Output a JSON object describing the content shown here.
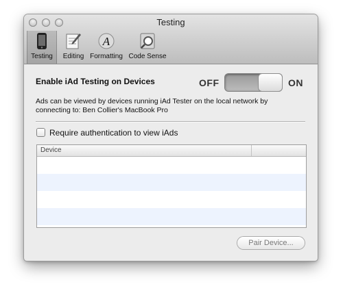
{
  "window": {
    "title": "Testing"
  },
  "toolbar": {
    "items": [
      {
        "label": "Testing",
        "icon": "iphone-icon",
        "selected": true
      },
      {
        "label": "Editing",
        "icon": "notepad-pencil-icon",
        "selected": false
      },
      {
        "label": "Formatting",
        "icon": "font-letter-icon",
        "selected": false
      },
      {
        "label": "Code Sense",
        "icon": "code-sense-icon",
        "selected": false
      }
    ]
  },
  "testing": {
    "heading": "Enable iAd Testing on Devices",
    "switch_off_label": "OFF",
    "switch_on_label": "ON",
    "switch_state": "on",
    "description": "Ads can be viewed by devices running iAd Tester on the local network by connecting to: Ben Collier's MacBook Pro",
    "auth_checkbox_label": "Require authentication to view iAds",
    "auth_checked": false
  },
  "devices_table": {
    "columns": [
      "Device",
      ""
    ],
    "rows": []
  },
  "actions": {
    "pair_label": "Pair Device..."
  },
  "colors": {
    "window_bg": "#ececec",
    "alt_row": "#edf3fe"
  }
}
